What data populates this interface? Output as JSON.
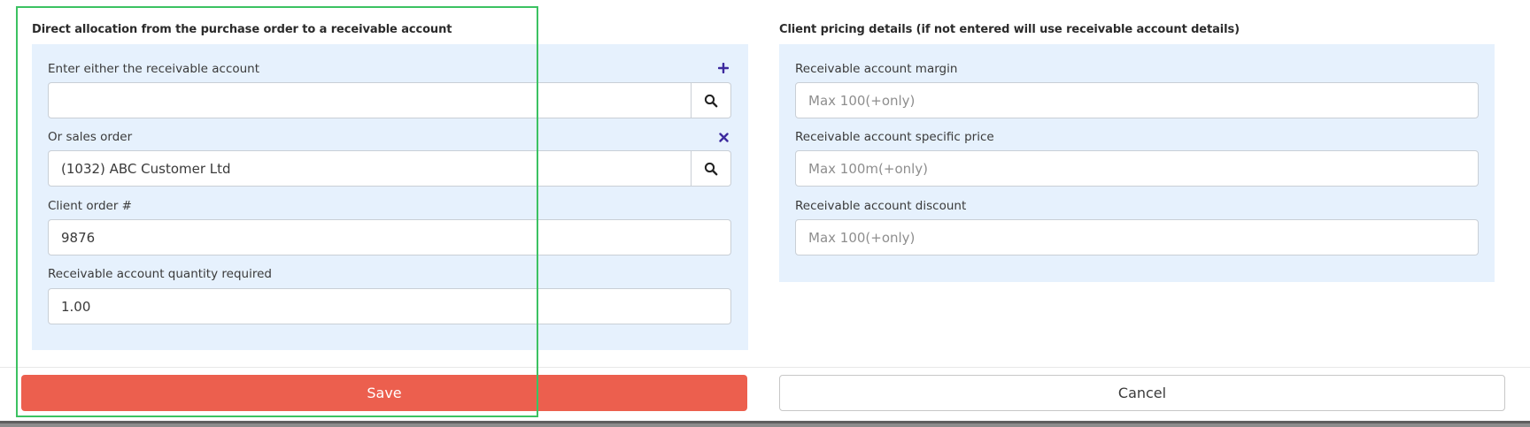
{
  "allocation": {
    "title": "Direct allocation from the purchase order to a receivable account",
    "receivable_account": {
      "label": "Enter either the receivable account",
      "value": "",
      "add_icon": "plus-icon",
      "search_icon": "search-icon"
    },
    "sales_order": {
      "label": "Or sales order",
      "value": "(1032) ABC Customer Ltd",
      "clear_icon": "close-icon",
      "search_icon": "search-icon"
    },
    "client_order": {
      "label": "Client order #",
      "value": "9876"
    },
    "quantity": {
      "label": "Receivable account quantity required",
      "value": "1.00"
    }
  },
  "pricing": {
    "title": "Client pricing details (if not entered will use receivable account details)",
    "margin": {
      "label": "Receivable account margin",
      "placeholder": "Max 100(+only)",
      "value": ""
    },
    "specific_price": {
      "label": "Receivable account specific price",
      "placeholder": "Max 100m(+only)",
      "value": ""
    },
    "discount": {
      "label": "Receivable account discount",
      "placeholder": "Max 100(+only)",
      "value": ""
    }
  },
  "actions": {
    "save_label": "Save",
    "cancel_label": "Cancel"
  },
  "colors": {
    "panel_bg": "#e6f1fd",
    "save_bg": "#ec5f4e",
    "icon_accent": "#3d2a9e",
    "focus_outline": "#3cc262"
  }
}
